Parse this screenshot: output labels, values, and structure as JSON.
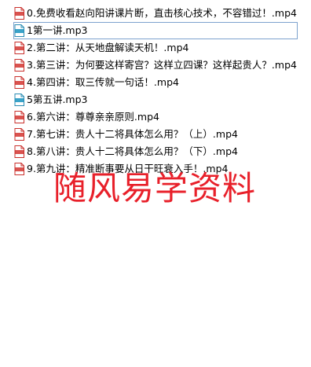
{
  "colors": {
    "mp4_icon": "#d9534f",
    "mp3_icon": "#3aa3c9",
    "selection_border": "#7da2ce",
    "watermark": "#e8202a"
  },
  "files": [
    {
      "name": "0.免费收看赵向阳讲课片断，直击核心技术，不容错过！.mp4",
      "icon": "mp4-file-icon",
      "selected": false
    },
    {
      "name": "1第一讲.mp3",
      "icon": "mp3-file-icon",
      "selected": true
    },
    {
      "name": "2.第二讲：从天地盘解读天机！.mp4",
      "icon": "mp4-file-icon",
      "selected": false
    },
    {
      "name": "3.第三讲：为何要这样寄宫？这样立四课？这样起贵人？.mp4",
      "icon": "mp4-file-icon",
      "selected": false
    },
    {
      "name": "4.第四讲：取三传就一句话！.mp4",
      "icon": "mp4-file-icon",
      "selected": false
    },
    {
      "name": "5第五讲.mp3",
      "icon": "mp3-file-icon",
      "selected": false
    },
    {
      "name": "6.第六讲：尊尊亲亲原则.mp4",
      "icon": "mp4-file-icon",
      "selected": false
    },
    {
      "name": "7.第七讲：贵人十二将具体怎么用？（上）.mp4",
      "icon": "mp4-file-icon",
      "selected": false
    },
    {
      "name": "8.第八讲：贵人十二将具体怎么用？（下）.mp4",
      "icon": "mp4-file-icon",
      "selected": false
    },
    {
      "name": "9.第九讲：精准断事要从日干旺衰入手！.mp4",
      "icon": "mp4-file-icon",
      "selected": false
    }
  ],
  "watermark": {
    "text": "随风易学资料"
  }
}
